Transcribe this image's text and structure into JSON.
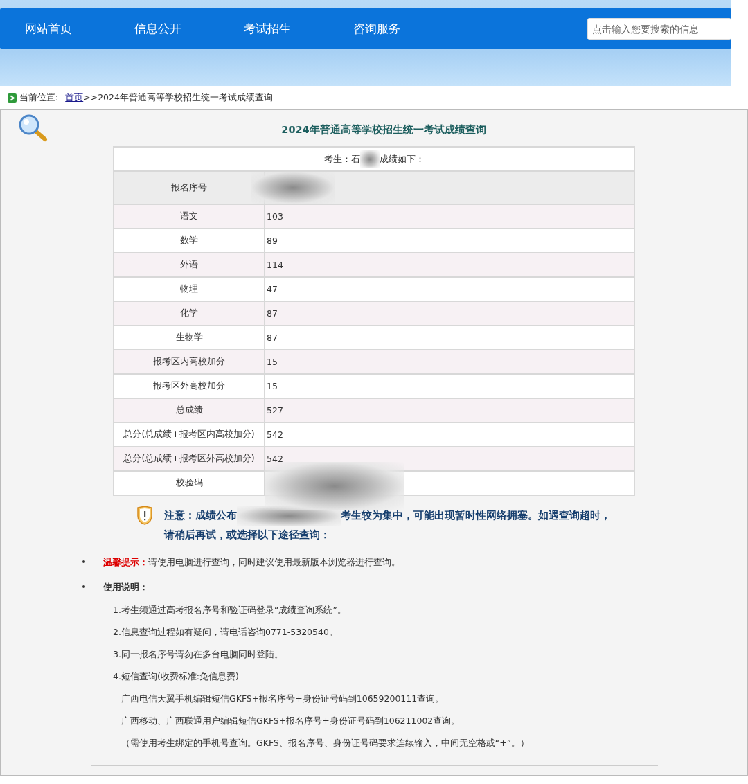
{
  "nav": {
    "items": [
      {
        "label": "网站首页"
      },
      {
        "label": "信息公开"
      },
      {
        "label": "考试招生"
      },
      {
        "label": "咨询服务"
      }
    ],
    "search": {
      "placeholder": "点击输入您要搜索的信息"
    }
  },
  "breadcrumb": {
    "label": "当前位置:",
    "link": "首页",
    "trail": ">>2024年普通高等学校招生统一考试成绩查询"
  },
  "title": "2024年普通高等学校招生统一考试成绩查询",
  "candidate": {
    "prefix": "考生：石",
    "suffix": "成绩如下："
  },
  "rows": [
    {
      "label": "报名序号",
      "value": "",
      "kind": "header"
    },
    {
      "label": "语文",
      "value": "103",
      "kind": "score"
    },
    {
      "label": "数学",
      "value": "89",
      "kind": "score"
    },
    {
      "label": "外语",
      "value": "114",
      "kind": "score"
    },
    {
      "label": "物理",
      "value": "47",
      "kind": "score"
    },
    {
      "label": "化学",
      "value": "87",
      "kind": "score"
    },
    {
      "label": "生物学",
      "value": "87",
      "kind": "score"
    },
    {
      "label": "报考区内高校加分",
      "value": "15",
      "kind": "score"
    },
    {
      "label": "报考区外高校加分",
      "value": "15",
      "kind": "score"
    },
    {
      "label": "总成绩",
      "value": "527",
      "kind": "score"
    },
    {
      "label": "总分(总成绩+报考区内高校加分)",
      "value": "542",
      "kind": "score"
    },
    {
      "label": "总分(总成绩+报考区外高校加分)",
      "value": "542",
      "kind": "score"
    },
    {
      "label": "校验码",
      "value": "",
      "kind": "score"
    }
  ],
  "notice": {
    "part_a": "注意：成绩公布",
    "part_b": "考生较为集中，可能出现暂时性网络拥塞。如遇查询超时，",
    "line_2": "请稍后再试，或选择以下途径查询："
  },
  "tip": {
    "label": "温馨提示：",
    "text": "请使用电脑进行查询，同时建议使用最新版本浏览器进行查询。"
  },
  "usage": {
    "heading": "使用说明：",
    "lines": [
      {
        "text": "1.考生须通过高考报名序号和验证码登录“成绩查询系统”。",
        "indent": false
      },
      {
        "text": "2.信息查询过程如有疑问，请电话咨询0771-5320540。",
        "indent": false
      },
      {
        "text": "3.同一报名序号请勿在多台电脑同时登陆。",
        "indent": false
      },
      {
        "text": "4.短信查询(收费标准:免信息费)",
        "indent": false
      },
      {
        "text": "广西电信天翼手机编辑短信GKFS+报名序号+身份证号码到10659200111查询。",
        "indent": true
      },
      {
        "text": "广西移动、广西联通用户编辑短信GKFS+报名序号+身份证号码到106211002查询。",
        "indent": true
      },
      {
        "text": "（需使用考生绑定的手机号查询。GKFS、报名序号、身份证号码要求连续输入，中间无空格或“+”。）",
        "indent": true
      }
    ]
  }
}
